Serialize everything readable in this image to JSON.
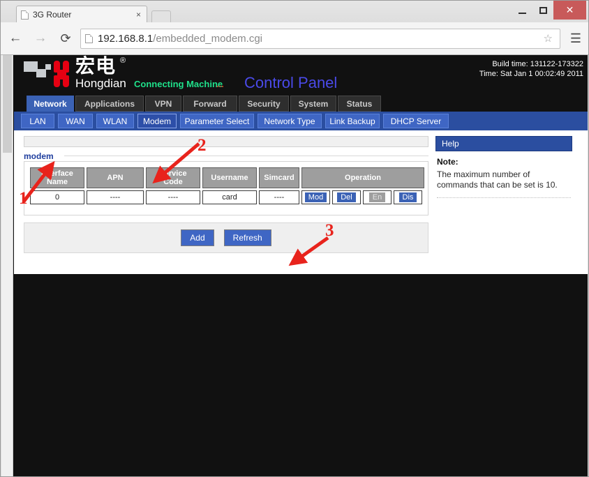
{
  "browser": {
    "tab_title": "3G Router",
    "tab_close": "×",
    "url_host": "192.168.8.1",
    "url_path": "/embedded_modem.cgi",
    "back_icon": "←",
    "forward_icon": "→",
    "reload_icon": "⟳",
    "star_icon": "☆",
    "menu_icon": "☰",
    "minimize_label": "",
    "maximize_label": "",
    "close_label": "✕"
  },
  "brand": {
    "cn_name": "宏电",
    "reg_mark": "®",
    "en_name": "Hongdian",
    "slogan": "Connecting Machine",
    "slogan_dots": "...",
    "control_panel": "Control Panel",
    "build_time": "Build time: 131122-173322",
    "time": "Time: Sat Jan 1 00:02:49 2011"
  },
  "main_tabs": [
    {
      "label": "Network",
      "active": true
    },
    {
      "label": "Applications",
      "active": false
    },
    {
      "label": "VPN",
      "active": false
    },
    {
      "label": "Forward",
      "active": false
    },
    {
      "label": "Security",
      "active": false
    },
    {
      "label": "System",
      "active": false
    },
    {
      "label": "Status",
      "active": false
    }
  ],
  "sub_tabs": [
    {
      "label": "LAN",
      "active": false
    },
    {
      "label": "WAN",
      "active": false
    },
    {
      "label": "WLAN",
      "active": false
    },
    {
      "label": "Modem",
      "active": true
    },
    {
      "label": "Parameter Select",
      "active": false
    },
    {
      "label": "Network Type",
      "active": false
    },
    {
      "label": "Link Backup",
      "active": false
    },
    {
      "label": "DHCP Server",
      "active": false
    }
  ],
  "section": {
    "label": "modem"
  },
  "table": {
    "headers": [
      "Interface Name",
      "APN",
      "Service Code",
      "Username",
      "Simcard",
      "Operation"
    ],
    "rows": [
      {
        "interface_name": "0",
        "apn": "----",
        "service_code": "----",
        "username": "card",
        "simcard": "----",
        "operations": [
          {
            "label": "Mod",
            "enabled": true
          },
          {
            "label": "Del",
            "enabled": true
          },
          {
            "label": "En",
            "enabled": false
          },
          {
            "label": "Dis",
            "enabled": true
          }
        ]
      }
    ]
  },
  "actions": {
    "add_label": "Add",
    "refresh_label": "Refresh"
  },
  "help": {
    "title": "Help",
    "note_label": "Note:",
    "note_text": "The maximum number of commands that can be set is 10."
  },
  "annotations": [
    {
      "number": "1"
    },
    {
      "number": "2"
    },
    {
      "number": "3"
    }
  ],
  "colors": {
    "accent_blue": "#3b62b5",
    "subtab_blue": "#2b4ea0",
    "brand_red": "#e60012",
    "slogan_green": "#1fe08a",
    "annotation_red": "#e8231c",
    "header_gray": "#9e9e9e"
  }
}
